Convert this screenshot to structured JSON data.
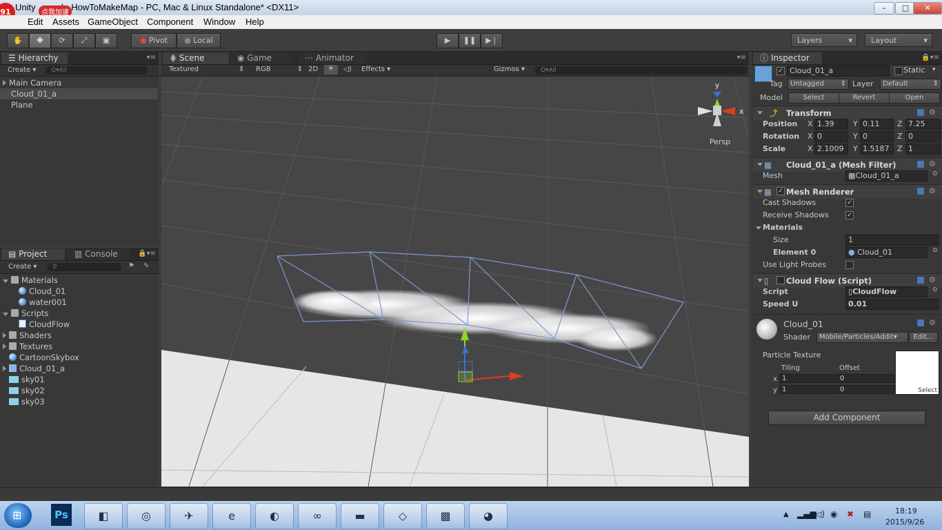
{
  "window": {
    "title_left": "Unity",
    "title_mid": "ed - HowToMakeMap - PC, Mac & Linux Standalone* <DX11>",
    "badge_count": "91",
    "badge_bubble": "点我加速",
    "controls": {
      "minimize": "–",
      "maximize": "□",
      "close": "✕"
    }
  },
  "menu": [
    "Edit",
    "Assets",
    "GameObject",
    "Component",
    "Window",
    "Help"
  ],
  "toolbar": {
    "pivot": "Pivot",
    "local": "Local",
    "layers": "Layers",
    "layout": "Layout"
  },
  "hierarchy": {
    "tab": "Hierarchy",
    "create": "Create",
    "search": "Q▾All",
    "items": [
      {
        "label": "Main Camera",
        "expandable": true
      },
      {
        "label": "Cloud_01_a",
        "selected": true
      },
      {
        "label": "Plane"
      }
    ]
  },
  "scene": {
    "tabs": [
      "Scene",
      "Game",
      "Animator"
    ],
    "textured": "Textured",
    "rgb": "RGB",
    "mode2d": "2D",
    "effects": "Effects",
    "gizmos": "Gizmos",
    "search": "Q▾All",
    "persp": "Persp",
    "axis_y": "y",
    "axis_x": "x"
  },
  "project": {
    "tabs": [
      "Project",
      "Console"
    ],
    "create": "Create",
    "items": [
      {
        "label": "Materials",
        "icon": "folder",
        "level": 0,
        "expanded": true
      },
      {
        "label": "Cloud_01",
        "icon": "material-sphere",
        "level": 1
      },
      {
        "label": "water001",
        "icon": "material-sphere",
        "level": 1
      },
      {
        "label": "Scripts",
        "icon": "folder",
        "level": 0,
        "expanded": true
      },
      {
        "label": "CloudFlow",
        "icon": "script",
        "level": 1
      },
      {
        "label": "Shaders",
        "icon": "folder",
        "level": 0
      },
      {
        "label": "Textures",
        "icon": "folder",
        "level": 0
      },
      {
        "label": "CartoonSkybox",
        "icon": "material-sphere",
        "level": 0
      },
      {
        "label": "Cloud_01_a",
        "icon": "prefab",
        "level": 0,
        "expandable": true
      },
      {
        "label": "sky01",
        "icon": "texture",
        "level": 0
      },
      {
        "label": "sky02",
        "icon": "texture",
        "level": 0
      },
      {
        "label": "sky03",
        "icon": "texture",
        "level": 0
      }
    ]
  },
  "inspector": {
    "tab": "Inspector",
    "object_name": "Cloud_01_a",
    "static_label": "Static",
    "tag_label": "Tag",
    "tag_value": "Untagged",
    "layer_label": "Layer",
    "layer_value": "Default",
    "model_label": "Model",
    "model_buttons": [
      "Select",
      "Revert",
      "Open"
    ],
    "transform": {
      "title": "Transform",
      "position": {
        "label": "Position",
        "x": "1.39",
        "y": "0.11",
        "z": "7.25"
      },
      "rotation": {
        "label": "Rotation",
        "x": "0",
        "y": "0",
        "z": "0"
      },
      "scale": {
        "label": "Scale",
        "x": "2.1009",
        "y": "1.5187",
        "z": "1"
      }
    },
    "mesh_filter": {
      "title": "Cloud_01_a (Mesh Filter)",
      "mesh_label": "Mesh",
      "mesh_value": "Cloud_01_a"
    },
    "mesh_renderer": {
      "title": "Mesh Renderer",
      "cast_shadows": "Cast Shadows",
      "receive_shadows": "Receive Shadows",
      "materials": "Materials",
      "size_label": "Size",
      "size_value": "1",
      "element0_label": "Element 0",
      "element0_value": "Cloud_01",
      "light_probes": "Use Light Probes"
    },
    "cloud_flow": {
      "title": "Cloud Flow (Script)",
      "script_label": "Script",
      "script_value": "CloudFlow",
      "speed_label": "Speed U",
      "speed_value": "0.01"
    },
    "material": {
      "name": "Cloud_01",
      "shader_label": "Shader",
      "shader_value": "Mobile/Particles/Addit▾",
      "edit": "Edit...",
      "particle_texture": "Particle Texture",
      "tiling": "Tiling",
      "offset": "Offset",
      "x": "x",
      "y": "y",
      "tiling_x": "1",
      "tiling_y": "1",
      "offset_x": "0",
      "offset_y": "0",
      "select": "Select"
    },
    "add_component": "Add Component"
  },
  "taskbar": {
    "time": "18:19",
    "date": "2015/9/26",
    "ps_label": "Ps"
  }
}
